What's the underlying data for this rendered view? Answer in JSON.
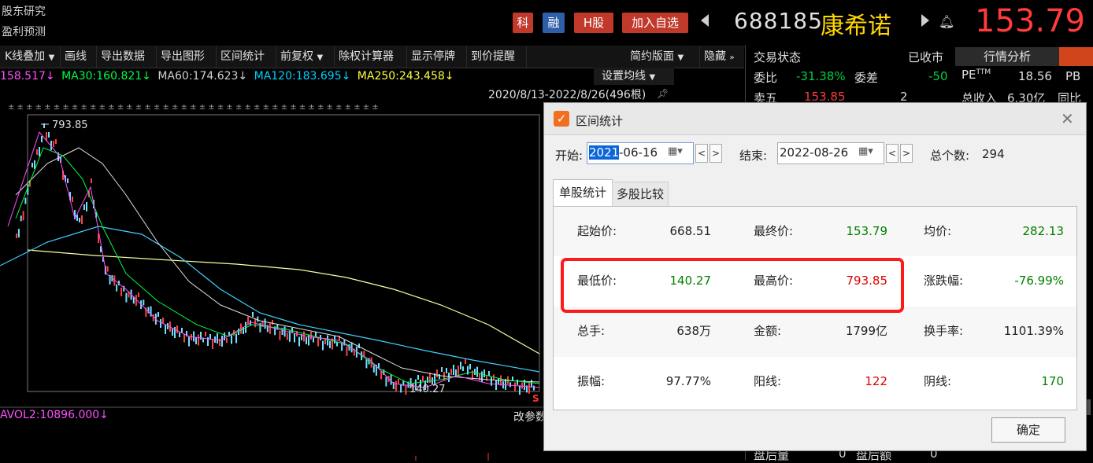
{
  "header": {
    "side_links": [
      "股东研究",
      "盈利预测"
    ],
    "tags": [
      {
        "label": "科",
        "color": "#c0392b"
      },
      {
        "label": "融",
        "color": "#2e5fa8"
      },
      {
        "label": "H股",
        "color": "#c0392b"
      },
      {
        "label": "加入自选",
        "color": "#c0392b"
      }
    ],
    "stock_code": "688185",
    "stock_name": "康希诺",
    "price": "153.79"
  },
  "toolbar": {
    "items": [
      "K线叠加",
      "画线",
      "导出数据",
      "导出图形",
      "区间统计",
      "前复权",
      "除权计算器",
      "显示停牌",
      "到价提醒",
      "简约版面",
      "隐藏"
    ]
  },
  "chart": {
    "ma": [
      {
        "text": "158.517↓",
        "color": "#ff4fff"
      },
      {
        "text": "MA30:160.821↓",
        "color": "#00ff40"
      },
      {
        "text": "MA60:174.623↓",
        "color": "#d0d0d0"
      },
      {
        "text": "MA120:183.695↓",
        "color": "#00d0ff"
      },
      {
        "text": "MA250:243.458↓",
        "color": "#ffff40"
      }
    ],
    "ma_settings": "设置均线",
    "date_range": "2020/8/13-2022/8/26(496根)",
    "high_label": "793.85",
    "low_label": "140.27",
    "vol_label": "AVOL2:10896.000↓",
    "modify_params": "改参数"
  },
  "right_panel": {
    "trade_status_label": "交易状态",
    "trade_status_value": "已收市",
    "tab_label": "行情分析",
    "weibi_label": "委比",
    "weibi_value": "-31.38%",
    "weicha_label": "委差",
    "weicha_value": "-50",
    "mai5_label": "卖五",
    "mai5_price": "153.85",
    "mai5_vol": "2",
    "pe_label": "PE",
    "pe_sup": "TTM",
    "pe_value": "18.56",
    "pb_label": "PB",
    "revenue_label": "总收入",
    "revenue_value": "6.30亿",
    "yoy_label": "同比",
    "after_vol_label": "盘后量",
    "after_vol_value": "0",
    "after_amt_label": "盘后额",
    "after_amt_value": "0"
  },
  "dialog": {
    "title": "区间统计",
    "start_label": "开始:",
    "start_year": "2021",
    "start_rest": "-06-16",
    "end_label": "结束:",
    "end_date": "2022-08-26",
    "total_label": "总个数:",
    "total_value": "294",
    "tabs": [
      "单股统计",
      "多股比较"
    ],
    "rows": [
      [
        {
          "label": "起始价:",
          "value": "668.51",
          "color": "#222222"
        },
        {
          "label": "最终价:",
          "value": "153.79",
          "color": "#008000"
        },
        {
          "label": "均价:",
          "value": "282.13",
          "color": "#008000"
        }
      ],
      [
        {
          "label": "最低价:",
          "value": "140.27",
          "color": "#008000"
        },
        {
          "label": "最高价:",
          "value": "793.85",
          "color": "#e00000"
        },
        {
          "label": "涨跌幅:",
          "value": "-76.99%",
          "color": "#008000"
        }
      ],
      [
        {
          "label": "总手:",
          "value": "638万",
          "color": "#222222"
        },
        {
          "label": "金额:",
          "value": "1799亿",
          "color": "#222222"
        },
        {
          "label": "换手率:",
          "value": "1101.39%",
          "color": "#222222"
        }
      ],
      [
        {
          "label": "振幅:",
          "value": "97.77%",
          "color": "#222222"
        },
        {
          "label": "阳线:",
          "value": "122",
          "color": "#e00000"
        },
        {
          "label": "阴线:",
          "value": "170",
          "color": "#008000"
        }
      ]
    ],
    "ok_label": "确定"
  }
}
